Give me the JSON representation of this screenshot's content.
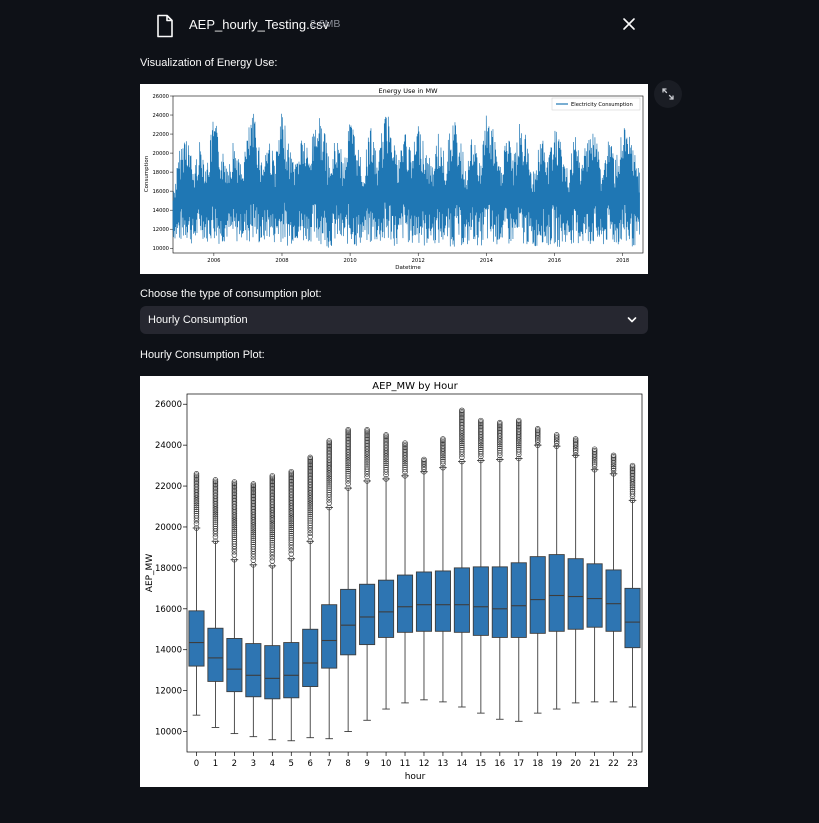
{
  "file": {
    "name": "AEP_hourly_Testing.csv",
    "size": "2.6MB",
    "icon": "file-icon",
    "close_icon": "close-icon"
  },
  "section1": {
    "label": "Visualization of Energy Use:"
  },
  "select": {
    "label": "Choose the type of consumption plot:",
    "value": "Hourly Consumption"
  },
  "section2": {
    "label": "Hourly Consumption Plot:"
  },
  "colors": {
    "background": "#0e1117",
    "widget": "#262730",
    "series": "#1f77b4",
    "box": "#2e75b2"
  },
  "chart_data": [
    {
      "type": "line",
      "title": "Energy Use in MW",
      "xlabel": "Datetime",
      "ylabel": "Consumption",
      "xlim": [
        2004.8,
        2018.6
      ],
      "ylim": [
        9500,
        26000
      ],
      "xticks": [
        "2006",
        "2008",
        "2010",
        "2012",
        "2014",
        "2016",
        "2018"
      ],
      "yticks": [
        "10000",
        "12000",
        "14000",
        "16000",
        "18000",
        "20000",
        "22000",
        "24000",
        "26000"
      ],
      "grid": false,
      "legend": "top-right",
      "series": [
        {
          "name": "Electricity Consumption",
          "x": [
            2004.8,
            2005.0,
            2005.2,
            2005.4,
            2005.6,
            2005.8,
            2006.0,
            2006.2,
            2006.4,
            2006.6,
            2006.8,
            2007.0,
            2007.2,
            2007.4,
            2007.6,
            2007.8,
            2008.0,
            2008.2,
            2008.4,
            2008.6,
            2008.8,
            2009.0,
            2009.2,
            2009.4,
            2009.6,
            2009.8,
            2010.0,
            2010.2,
            2010.4,
            2010.6,
            2010.8,
            2011.0,
            2011.2,
            2011.4,
            2011.6,
            2011.8,
            2012.0,
            2012.2,
            2012.4,
            2012.6,
            2012.8,
            2013.0,
            2013.2,
            2013.4,
            2013.6,
            2013.8,
            2014.0,
            2014.2,
            2014.4,
            2014.6,
            2014.8,
            2015.0,
            2015.2,
            2015.4,
            2015.6,
            2015.8,
            2016.0,
            2016.2,
            2016.4,
            2016.6,
            2016.8,
            2017.0,
            2017.2,
            2017.4,
            2017.6,
            2017.8,
            2018.0,
            2018.2,
            2018.5
          ],
          "min": [
            11000,
            10500,
            10800,
            10200,
            11200,
            10600,
            10800,
            10300,
            10900,
            10200,
            11100,
            10400,
            10600,
            10100,
            11000,
            10400,
            10700,
            10100,
            10900,
            10300,
            10800,
            10200,
            10500,
            9900,
            10700,
            10100,
            10400,
            9900,
            10800,
            10200,
            10600,
            10000,
            10400,
            9900,
            10900,
            10200,
            10500,
            10000,
            10700,
            10100,
            10600,
            10000,
            10400,
            9900,
            10800,
            10100,
            10500,
            9900,
            10700,
            10000,
            10600,
            10000,
            10300,
            9800,
            10700,
            10100,
            10400,
            9900,
            10800,
            10100,
            10500,
            10000,
            10300,
            9900,
            10700,
            10100,
            10400,
            10000,
            10300
          ],
          "max": [
            16000,
            20500,
            22800,
            18500,
            21500,
            19000,
            24200,
            20500,
            19500,
            21800,
            18500,
            22500,
            24600,
            19500,
            22000,
            19500,
            24400,
            21000,
            19200,
            22800,
            19800,
            24800,
            23500,
            18800,
            22200,
            19500,
            24000,
            21500,
            18500,
            23500,
            19200,
            23800,
            25400,
            19000,
            23200,
            19800,
            23500,
            21000,
            18800,
            22500,
            19500,
            24200,
            22000,
            18800,
            22000,
            19200,
            24500,
            22500,
            18500,
            22800,
            19500,
            23600,
            21500,
            18200,
            22400,
            19300,
            23400,
            20800,
            18000,
            22000,
            19000,
            23200,
            22500,
            18200,
            22200,
            19300,
            23000,
            21800,
            18500
          ]
        }
      ]
    },
    {
      "type": "box",
      "title": "AEP_MW by Hour",
      "xlabel": "hour",
      "ylabel": "AEP_MW",
      "ylim": [
        9000,
        26500
      ],
      "yticks": [
        "10000",
        "12000",
        "14000",
        "16000",
        "18000",
        "20000",
        "22000",
        "24000",
        "26000"
      ],
      "categories": [
        "0",
        "1",
        "2",
        "3",
        "4",
        "5",
        "6",
        "7",
        "8",
        "9",
        "10",
        "11",
        "12",
        "13",
        "14",
        "15",
        "16",
        "17",
        "18",
        "19",
        "20",
        "21",
        "22",
        "23"
      ],
      "series": [
        {
          "min": [
            10800,
            10200,
            9900,
            9750,
            9600,
            9550,
            9700,
            9650,
            10000,
            10550,
            11100,
            11400,
            11550,
            11450,
            11200,
            10900,
            10600,
            10500,
            10900,
            11100,
            11400,
            11450,
            11450,
            11200
          ],
          "q1": [
            13200,
            12450,
            11950,
            11700,
            11600,
            11650,
            12200,
            13100,
            13750,
            14250,
            14600,
            14850,
            14900,
            14900,
            14850,
            14700,
            14600,
            14600,
            14800,
            14900,
            15000,
            15100,
            14900,
            14100
          ],
          "median": [
            14350,
            13600,
            13050,
            12750,
            12600,
            12750,
            13350,
            14450,
            15200,
            15600,
            15850,
            16100,
            16200,
            16200,
            16200,
            16100,
            16000,
            16150,
            16450,
            16650,
            16600,
            16500,
            16250,
            15350
          ],
          "q3": [
            15900,
            15050,
            14550,
            14300,
            14200,
            14350,
            15000,
            16200,
            16950,
            17200,
            17400,
            17650,
            17800,
            17850,
            18000,
            18050,
            18050,
            18250,
            18550,
            18650,
            18450,
            18200,
            17900,
            17000
          ],
          "max": [
            19950,
            19300,
            18400,
            18150,
            18100,
            18450,
            19300,
            20950,
            21900,
            22250,
            22350,
            22500,
            22700,
            22900,
            23200,
            23250,
            23300,
            23350,
            24000,
            23950,
            23500,
            22800,
            22600,
            21300
          ],
          "outlier_max": [
            22600,
            22300,
            22200,
            22100,
            22500,
            22700,
            23400,
            24200,
            24750,
            24750,
            24500,
            24100,
            23300,
            24300,
            25700,
            25200,
            25100,
            25200,
            24800,
            24500,
            24300,
            23800,
            23500,
            23000
          ]
        }
      ]
    }
  ]
}
